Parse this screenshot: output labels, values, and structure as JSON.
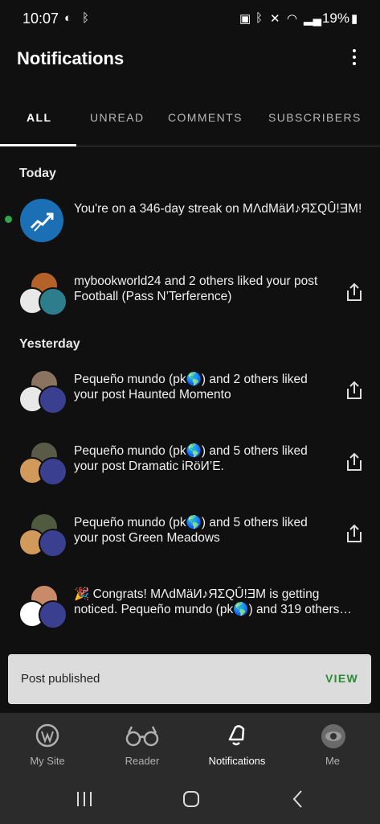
{
  "status_bar": {
    "time": "10:07",
    "battery": "19%"
  },
  "header": {
    "title": "Notifications"
  },
  "tabs": [
    {
      "label": "ALL",
      "active": true
    },
    {
      "label": "UNREAD"
    },
    {
      "label": "COMMENTS"
    },
    {
      "label": "SUBSCRIBERS"
    }
  ],
  "sections": {
    "today": "Today",
    "yesterday": "Yesterday"
  },
  "notifications": [
    {
      "text": "You're on a 346-day streak on MΛdMäИ♪ЯΣQÛ!ƎM!",
      "unread": true
    },
    {
      "text": "mybookworld24 and 2 others liked your post  Football (Pass N’Terference)"
    },
    {
      "text": "Pequeño mundo (pk🌎) and 2 others liked your post Haunted Momento"
    },
    {
      "text": "Pequeño mundo (pk🌎) and 5 others liked your post Dramatic iRöИ’E."
    },
    {
      "text": "Pequeño mundo (pk🌎) and 5 others liked your post Green Meadows"
    },
    {
      "text": "🎉 Congrats! MΛdMäИ♪ЯΣQÛ!ƎM is getting noticed. Pequeño mundo (pk🌎) and 319 others…"
    }
  ],
  "snackbar": {
    "message": "Post published",
    "action": "VIEW"
  },
  "bottom_nav": [
    {
      "label": "My Site"
    },
    {
      "label": "Reader"
    },
    {
      "label": "Notifications",
      "active": true
    },
    {
      "label": "Me"
    }
  ],
  "colors": {
    "background": "#101010",
    "accent_green": "#2c8a36",
    "unread_dot": "#2fa84b",
    "nav_bg": "#2b2b2b"
  }
}
